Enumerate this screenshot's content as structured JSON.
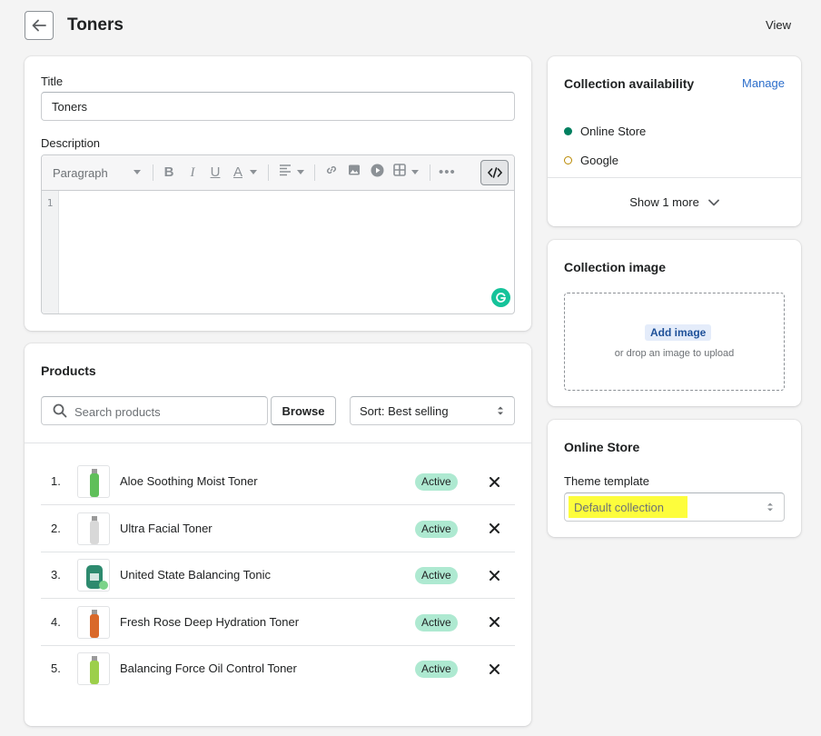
{
  "header": {
    "title": "Toners",
    "view_label": "View"
  },
  "title_card": {
    "title_label": "Title",
    "title_value": "Toners",
    "description_label": "Description",
    "editor": {
      "paragraph_label": "Paragraph",
      "line_number": "1"
    }
  },
  "products": {
    "heading": "Products",
    "search_placeholder": "Search products",
    "browse_label": "Browse",
    "sort_label": "Sort: Best selling",
    "items": [
      {
        "num": "1.",
        "name": "Aloe Soothing Moist Toner",
        "status": "Active",
        "thumb_color": "#5fbf5a"
      },
      {
        "num": "2.",
        "name": "Ultra Facial Toner",
        "status": "Active",
        "thumb_color": "#d8d8d8"
      },
      {
        "num": "3.",
        "name": "United State Balancing Tonic",
        "status": "Active",
        "thumb_color": "#2d8a6e"
      },
      {
        "num": "4.",
        "name": "Fresh Rose Deep Hydration Toner",
        "status": "Active",
        "thumb_color": "#d9692a"
      },
      {
        "num": "5.",
        "name": "Balancing Force Oil Control Toner",
        "status": "Active",
        "thumb_color": "#9ccf4a"
      }
    ]
  },
  "availability": {
    "heading": "Collection availability",
    "manage_label": "Manage",
    "channels": [
      {
        "name": "Online Store",
        "dot_color": "#007f5f",
        "filled": true
      },
      {
        "name": "Google",
        "dot_color": "#b98900",
        "filled": false
      }
    ],
    "show_more_label": "Show 1 more"
  },
  "collection_image": {
    "heading": "Collection image",
    "add_image_label": "Add image",
    "drop_hint": "or drop an image to upload"
  },
  "online_store": {
    "heading": "Online Store",
    "theme_label": "Theme template",
    "theme_value": "Default collection"
  },
  "colors": {
    "accent_link": "#2c6ecb",
    "badge_active": "#aee9d1",
    "highlight": "#fdfd3c"
  }
}
